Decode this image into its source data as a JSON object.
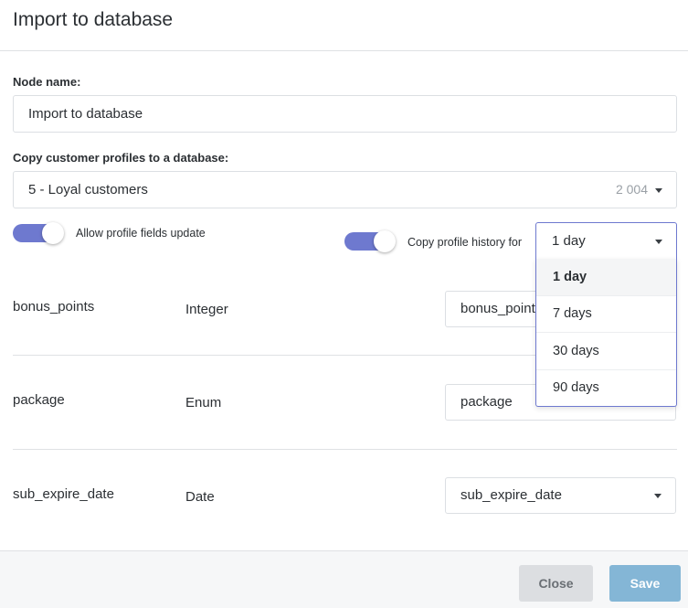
{
  "dialog": {
    "title": "Import to database"
  },
  "node_name": {
    "label": "Node name:",
    "value": "Import to database"
  },
  "copy_profiles": {
    "label": "Copy customer profiles to a database:",
    "selected": "5 - Loyal customers",
    "count": "2 004"
  },
  "toggles": {
    "allow_update": {
      "label": "Allow profile fields update",
      "on": true
    },
    "copy_history": {
      "label": "Copy profile history for",
      "on": true
    }
  },
  "history": {
    "selected": "1 day",
    "options": [
      "1 day",
      "7 days",
      "30 days",
      "90 days"
    ]
  },
  "fields": [
    {
      "name": "bonus_points",
      "type": "Integer",
      "mapping": "bonus_points"
    },
    {
      "name": "package",
      "type": "Enum",
      "mapping": "package"
    },
    {
      "name": "sub_expire_date",
      "type": "Date",
      "mapping": "sub_expire_date"
    }
  ],
  "footer": {
    "close_label": "Close",
    "save_label": "Save"
  },
  "colors": {
    "accent": "#6e79cf",
    "save_button": "#84b6d6",
    "close_button": "#dcdee1"
  },
  "icons": {
    "dropdown": "chevron-down-icon"
  }
}
